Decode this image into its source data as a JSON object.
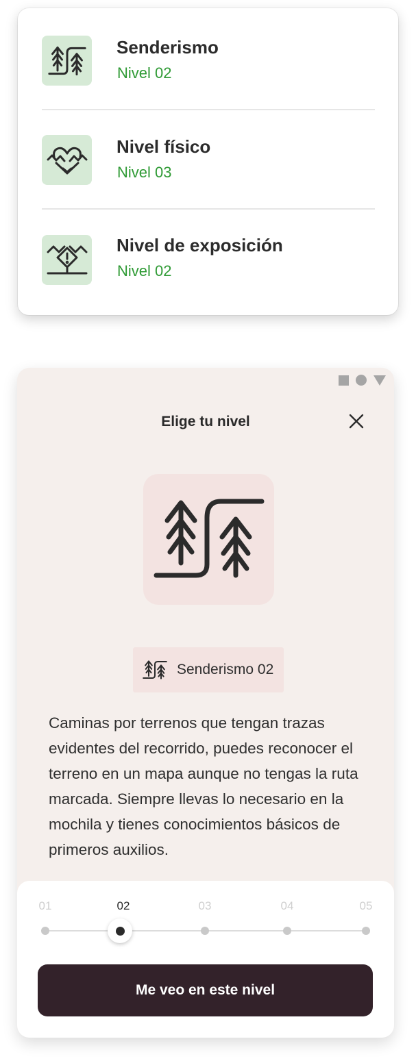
{
  "levels_card": {
    "items": [
      {
        "icon": "hiking-trees-icon",
        "title": "Senderismo",
        "level": "Nivel 02"
      },
      {
        "icon": "heart-pulse-icon",
        "title": "Nivel físico",
        "level": "Nivel 03"
      },
      {
        "icon": "exposure-warning-icon",
        "title": "Nivel de exposición",
        "level": "Nivel 02"
      }
    ]
  },
  "modal": {
    "title": "Elige tu nivel",
    "close_icon": "close-icon",
    "hero_icon": "hiking-trees-icon",
    "chip": {
      "icon": "hiking-trees-icon",
      "label": "Senderismo 02"
    },
    "description": "Caminas por terrenos que tengan trazas evidentes del recorrido, puedes reconocer el terreno en un mapa aunque no tengas la ruta marcada. Siempre llevas lo necesario en la mochila y tienes conocimientos básicos de primeros auxilios.",
    "level_selector": {
      "steps": [
        "01",
        "02",
        "03",
        "04",
        "05"
      ],
      "selected": "02"
    },
    "cta_label": "Me veo en este nivel"
  },
  "colors": {
    "level_green": "#2e9a34",
    "icon_bg_green": "#d6ead6",
    "modal_bg": "#f5efec",
    "icon_bg_pink": "#f3e3e1",
    "cta_bg": "#33222a"
  }
}
